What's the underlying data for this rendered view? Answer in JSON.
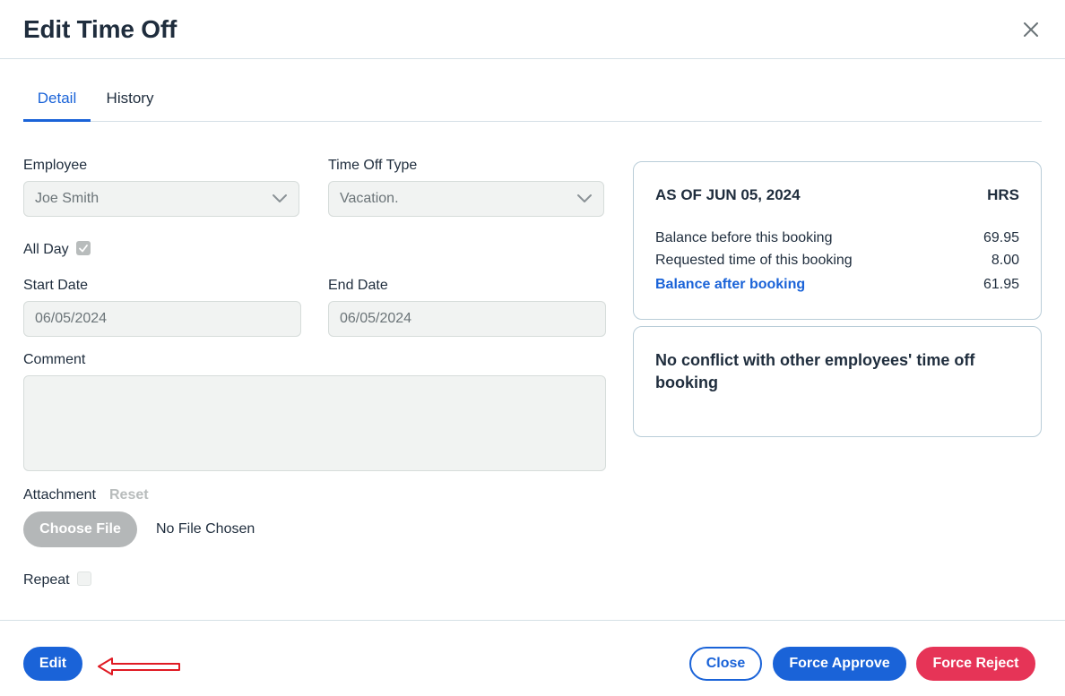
{
  "dialog": {
    "title": "Edit Time Off",
    "close_icon": "close-icon"
  },
  "tabs": [
    {
      "label": "Detail",
      "active": true
    },
    {
      "label": "History",
      "active": false
    }
  ],
  "form": {
    "employee": {
      "label": "Employee",
      "value": "Joe Smith"
    },
    "time_off_type": {
      "label": "Time Off Type",
      "value": "Vacation."
    },
    "all_day": {
      "label": "All Day",
      "checked": true
    },
    "start_date": {
      "label": "Start Date",
      "value": "06/05/2024"
    },
    "end_date": {
      "label": "End Date",
      "value": "06/05/2024"
    },
    "comment": {
      "label": "Comment",
      "value": ""
    },
    "attachment": {
      "label": "Attachment",
      "reset_label": "Reset",
      "choose_label": "Choose File",
      "status": "No File Chosen"
    },
    "repeat": {
      "label": "Repeat",
      "checked": false
    }
  },
  "balance": {
    "heading": "AS OF JUN 05, 2024",
    "unit": "HRS",
    "rows": [
      {
        "label": "Balance before this booking",
        "value": "69.95"
      },
      {
        "label": "Requested time of this booking",
        "value": "8.00"
      },
      {
        "label": "Balance after booking",
        "value": "61.95"
      }
    ]
  },
  "conflict": {
    "message": "No conflict with other employees' time off booking"
  },
  "footer": {
    "edit_label": "Edit",
    "close_label": "Close",
    "approve_label": "Force Approve",
    "reject_label": "Force Reject"
  },
  "colors": {
    "primary": "#1a63d8",
    "danger": "#e63457",
    "annotation_arrow": "#e01b24"
  }
}
